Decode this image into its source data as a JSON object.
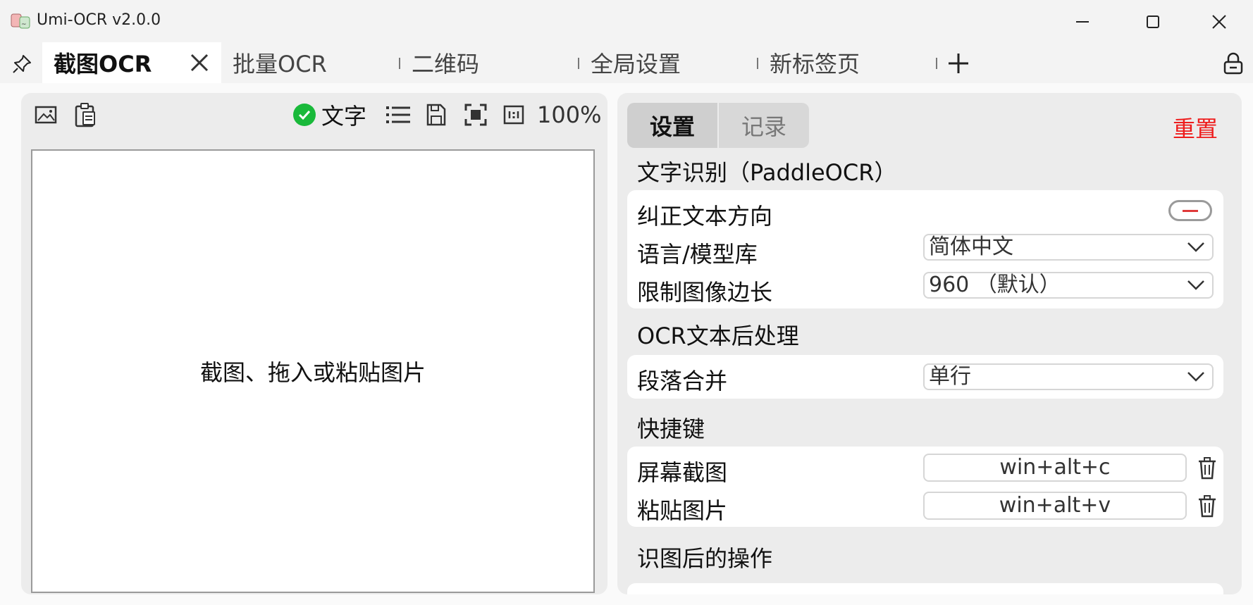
{
  "window": {
    "title": "Umi-OCR v2.0.0",
    "controls": {
      "minimize": "minimize-icon",
      "maximize": "maximize-icon",
      "close": "close-icon"
    }
  },
  "tabs": [
    {
      "label": "截图OCR",
      "active": true
    },
    {
      "label": "批量OCR",
      "active": false
    },
    {
      "label": "二维码",
      "active": false
    },
    {
      "label": "全局设置",
      "active": false
    },
    {
      "label": "新标签页",
      "active": false
    }
  ],
  "left": {
    "text_toggle_label": "文字",
    "zoom": "100%",
    "placeholder": "截图、拖入或粘贴图片"
  },
  "right": {
    "segments": [
      "设置",
      "记录"
    ],
    "reset": "重置",
    "sections": {
      "ocr_title": "文字识别（PaddleOCR）",
      "correct_direction": "纠正文本方向",
      "language_label": "语言/模型库",
      "language_value": "简体中文",
      "limit_label": "限制图像边长",
      "limit_value": "960 （默认）",
      "post_title": "OCR文本后处理",
      "merge_label": "段落合并",
      "merge_value": "单行",
      "hotkey_title": "快捷键",
      "screenshot_label": "屏幕截图",
      "screenshot_value": "win+alt+c",
      "paste_label": "粘贴图片",
      "paste_value": "win+alt+v",
      "after_title": "识图后的操作"
    }
  },
  "colors": {
    "reset": "#ee1c1c",
    "check": "#19b93a",
    "toggle_minus": "#e03a3a"
  }
}
